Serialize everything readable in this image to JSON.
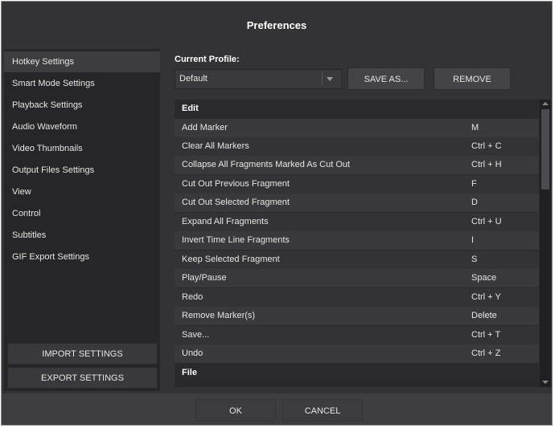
{
  "window": {
    "title": "Preferences"
  },
  "sidebar": {
    "items": [
      {
        "label": "Hotkey Settings"
      },
      {
        "label": "Smart Mode Settings"
      },
      {
        "label": "Playback Settings"
      },
      {
        "label": "Audio Waveform"
      },
      {
        "label": "Video Thumbnails"
      },
      {
        "label": "Output Files Settings"
      },
      {
        "label": "View"
      },
      {
        "label": "Control"
      },
      {
        "label": "Subtitles"
      },
      {
        "label": "GIF Export Settings"
      }
    ],
    "import_label": "IMPORT SETTINGS",
    "export_label": "EXPORT SETTINGS"
  },
  "profile": {
    "label": "Current Profile:",
    "value": "Default",
    "save_as_label": "SAVE AS...",
    "remove_label": "REMOVE"
  },
  "hotkeys": {
    "groups": [
      {
        "name": "Edit",
        "rows": [
          {
            "action": "Add Marker",
            "key": "M"
          },
          {
            "action": "Clear All Markers",
            "key": "Ctrl + C"
          },
          {
            "action": "Collapse All Fragments Marked As Cut Out",
            "key": "Ctrl + H"
          },
          {
            "action": "Cut Out Previous Fragment",
            "key": "F"
          },
          {
            "action": "Cut Out Selected Fragment",
            "key": "D"
          },
          {
            "action": "Expand All Fragments",
            "key": "Ctrl + U"
          },
          {
            "action": "Invert Time Line Fragments",
            "key": "I"
          },
          {
            "action": "Keep Selected Fragment",
            "key": "S"
          },
          {
            "action": "Play/Pause",
            "key": "Space"
          },
          {
            "action": "Redo",
            "key": "Ctrl + Y"
          },
          {
            "action": "Remove Marker(s)",
            "key": "Delete"
          },
          {
            "action": "Save...",
            "key": "Ctrl + T"
          },
          {
            "action": "Undo",
            "key": "Ctrl + Z"
          }
        ]
      },
      {
        "name": "File",
        "rows": []
      }
    ]
  },
  "footer": {
    "ok_label": "OK",
    "cancel_label": "CANCEL"
  }
}
